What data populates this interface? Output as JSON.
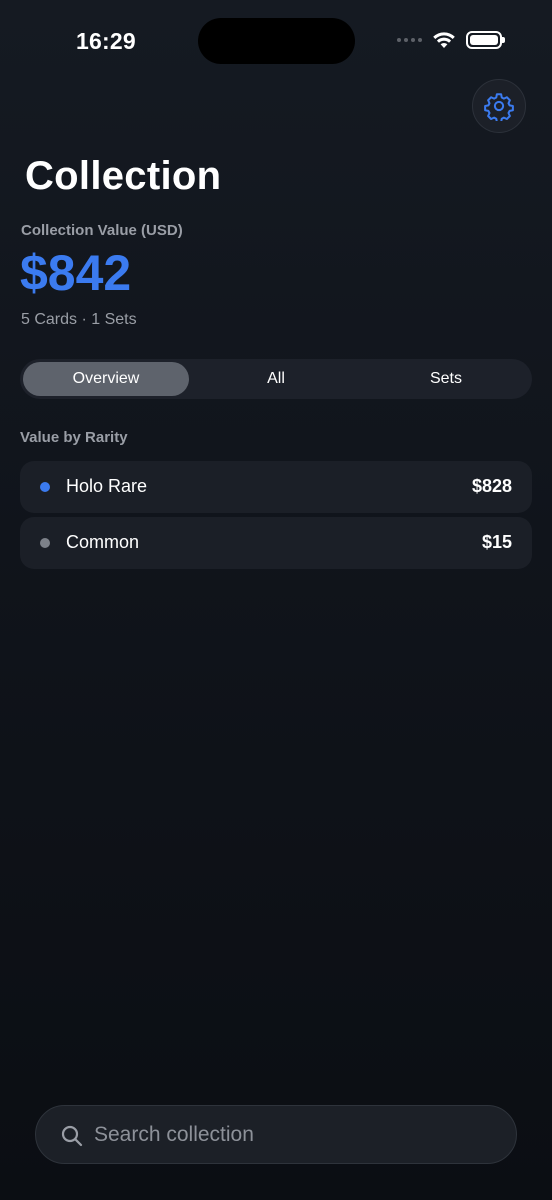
{
  "status_bar": {
    "time": "16:29"
  },
  "header": {
    "title": "Collection"
  },
  "summary": {
    "value_label": "Collection Value (USD)",
    "value": "$842",
    "subtitle": "5 Cards · 1 Sets"
  },
  "tabs": [
    {
      "label": "Overview",
      "selected": true
    },
    {
      "label": "All",
      "selected": false
    },
    {
      "label": "Sets",
      "selected": false
    }
  ],
  "rarity_section": {
    "label": "Value by Rarity",
    "items": [
      {
        "name": "Holo Rare",
        "value": "$828",
        "dot_color": "#3b7bf0"
      },
      {
        "name": "Common",
        "value": "$15",
        "dot_color": "#7d8189"
      }
    ]
  },
  "search": {
    "placeholder": "Search collection"
  },
  "colors": {
    "accent": "#3b7bf0",
    "background": "#10141b"
  }
}
